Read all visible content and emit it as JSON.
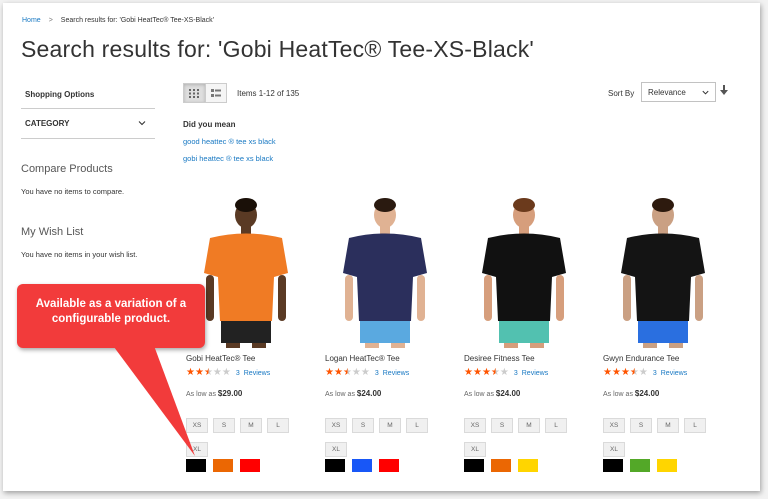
{
  "breadcrumb": {
    "home": "Home",
    "separator": ">",
    "current": "Search results for: 'Gobi HeatTec® Tee-XS-Black'"
  },
  "page_title": "Search results for: 'Gobi HeatTec® Tee-XS-Black'",
  "sidebar": {
    "shopping_options": "Shopping Options",
    "category": "CATEGORY",
    "compare_title": "Compare Products",
    "compare_text": "You have no items to compare.",
    "wishlist_title": "My Wish List",
    "wishlist_text": "You have no items in your wish list."
  },
  "toolbar": {
    "items_count": "Items 1-12 of 135",
    "sort_label": "Sort By",
    "sort_value": "Relevance",
    "view_modes": [
      "grid-icon",
      "list-icon"
    ]
  },
  "did_you_mean": {
    "title": "Did you mean",
    "suggestions": [
      "good heattec ® tee xs black",
      "gobi heattec ® tee xs black"
    ]
  },
  "products": [
    {
      "name": "Gobi HeatTec® Tee",
      "rating": 2.5,
      "reviews_count": "3",
      "reviews_label": "Reviews",
      "price_prefix": "As low as",
      "price": "$29.00",
      "sizes": [
        "XS",
        "S",
        "M",
        "L",
        "XL"
      ],
      "swatches": [
        "#000000",
        "#eb6703",
        "#ff0000"
      ],
      "shirt_color": "#f07b24",
      "shorts_color": "#222222",
      "skin": "#5a3a24",
      "hair": "#1a1008"
    },
    {
      "name": "Logan HeatTec® Tee",
      "rating": 2.5,
      "reviews_count": "3",
      "reviews_label": "Reviews",
      "price_prefix": "As low as",
      "price": "$24.00",
      "sizes": [
        "XS",
        "S",
        "M",
        "L",
        "XL"
      ],
      "swatches": [
        "#000000",
        "#1857f7",
        "#ff0000"
      ],
      "shirt_color": "#2b2f5c",
      "shorts_color": "#5aa9e0",
      "skin": "#e0b293",
      "hair": "#2a1a10"
    },
    {
      "name": "Desiree Fitness Tee",
      "rating": 3.5,
      "reviews_count": "3",
      "reviews_label": "Reviews",
      "price_prefix": "As low as",
      "price": "$24.00",
      "sizes": [
        "XS",
        "S",
        "M",
        "L",
        "XL"
      ],
      "swatches": [
        "#000000",
        "#eb6703",
        "#ffd500"
      ],
      "shirt_color": "#111111",
      "shorts_color": "#52c1b0",
      "skin": "#d69e7c",
      "hair": "#6b3a1c"
    },
    {
      "name": "Gwyn Endurance Tee",
      "rating": 3.5,
      "reviews_count": "3",
      "reviews_label": "Reviews",
      "price_prefix": "As low as",
      "price": "$24.00",
      "sizes": [
        "XS",
        "S",
        "M",
        "L",
        "XL"
      ],
      "swatches": [
        "#000000",
        "#53a828",
        "#ffd500"
      ],
      "shirt_color": "#141414",
      "shorts_color": "#2a6fe0",
      "skin": "#caa083",
      "hair": "#2d1a0e"
    }
  ],
  "callout": {
    "text": "Available as a variation of a configurable product.",
    "color": "#f23b3b"
  },
  "colors": {
    "link": "#1979c3",
    "star": "#ff5501"
  }
}
